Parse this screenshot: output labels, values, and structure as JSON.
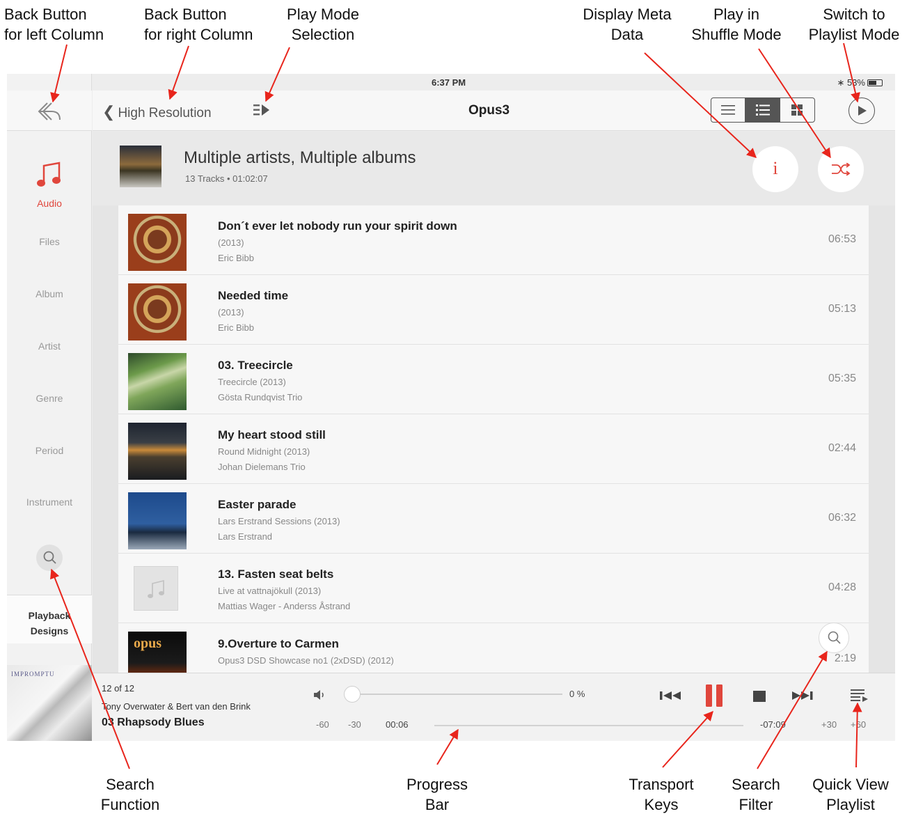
{
  "callouts": {
    "back_left": [
      "Back Button",
      "for left Column"
    ],
    "back_right": [
      "Back Button",
      "for right Column"
    ],
    "play_mode": [
      "Play Mode",
      "Selection"
    ],
    "meta": [
      "Display Meta",
      "Data"
    ],
    "shuffle": [
      "Play in",
      "Shuffle Mode"
    ],
    "playlist_mode": [
      "Switch to",
      "Playlist Mode"
    ],
    "search_function": [
      "Search",
      "Function"
    ],
    "progress_bar": [
      "Progress",
      "Bar"
    ],
    "transport": [
      "Transport",
      "Keys"
    ],
    "search_filter": [
      "Search",
      "Filter"
    ],
    "quick_view": [
      "Quick View",
      "Playlist"
    ]
  },
  "status": {
    "device": "iPad",
    "time": "6:37 PM",
    "battery": "53%"
  },
  "header": {
    "back_label": "High Resolution",
    "title": "Opus3"
  },
  "sidebar": {
    "items": [
      {
        "label": "Audio",
        "active": true
      },
      {
        "label": "Files"
      },
      {
        "label": "Album"
      },
      {
        "label": "Artist"
      },
      {
        "label": "Genre"
      },
      {
        "label": "Period"
      },
      {
        "label": "Instrument"
      }
    ],
    "renderer": [
      "Playback",
      "Designs"
    ]
  },
  "group": {
    "title": "Multiple artists,  Multiple albums",
    "subtitle": "13 Tracks  •  01:02:07",
    "info_glyph": "i"
  },
  "tracks": [
    {
      "title": "Don´t ever let nobody run your spirit down",
      "album": "(2013)",
      "artist": "Eric Bibb",
      "duration": "06:53"
    },
    {
      "title": "Needed time",
      "album": "(2013)",
      "artist": "Eric Bibb",
      "duration": "05:13"
    },
    {
      "title": "03. Treecircle",
      "album": "Treecircle (2013)",
      "artist": "Gösta Rundqvist Trio",
      "duration": "05:35"
    },
    {
      "title": "My heart stood still",
      "album": "Round Midnight (2013)",
      "artist": "Johan Dielemans Trio",
      "duration": "02:44"
    },
    {
      "title": "Easter parade",
      "album": "Lars Erstrand Sessions (2013)",
      "artist": "Lars Erstrand",
      "duration": "06:32"
    },
    {
      "title": "13. Fasten seat belts",
      "album": "Live at vattnajökull (2013)",
      "artist": "Mattias Wager - Anderss Åstrand",
      "duration": "04:28"
    },
    {
      "title": "9.Overture to Carmen",
      "album": "Opus3 DSD Showcase no1 (2xDSD) (2012)",
      "artist": "",
      "duration": "2:19",
      "art_text": "opus"
    }
  ],
  "player": {
    "now_art_text": "IMPROMPTU",
    "count": "12 of 12",
    "artist": "Tony Overwater & Bert van den Brink",
    "title": "03 Rhapsody Blues",
    "volume_label": "0 %",
    "volume_fraction": 0,
    "skip_back": [
      "-60",
      "-30"
    ],
    "position": "00:06",
    "remaining": "-07:09",
    "skip_fwd": [
      "+30",
      "+60"
    ]
  },
  "colors": {
    "accent": "#e0463c",
    "arrow": "#e8251c"
  }
}
